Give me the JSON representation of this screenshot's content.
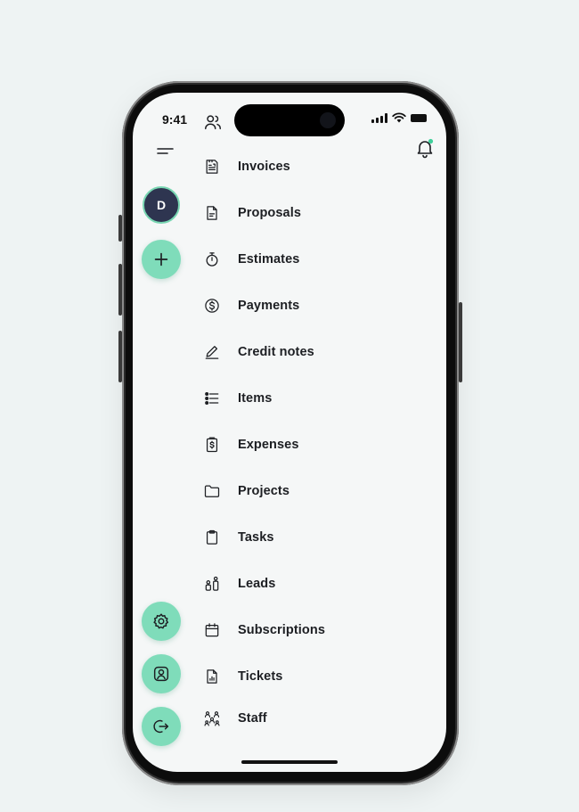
{
  "status_bar": {
    "time": "9:41"
  },
  "user": {
    "initial": "D"
  },
  "menu": {
    "items": [
      {
        "label": "Invoices",
        "icon": "invoice-icon"
      },
      {
        "label": "Proposals",
        "icon": "document-icon"
      },
      {
        "label": "Estimates",
        "icon": "stopwatch-icon"
      },
      {
        "label": "Payments",
        "icon": "dollar-circle-icon"
      },
      {
        "label": "Credit notes",
        "icon": "pencil-icon"
      },
      {
        "label": "Items",
        "icon": "list-icon"
      },
      {
        "label": "Expenses",
        "icon": "receipt-dollar-icon"
      },
      {
        "label": "Projects",
        "icon": "folder-icon"
      },
      {
        "label": "Tasks",
        "icon": "clipboard-icon"
      },
      {
        "label": "Leads",
        "icon": "people-icon"
      },
      {
        "label": "Subscriptions",
        "icon": "calendar-icon"
      },
      {
        "label": "Tickets",
        "icon": "report-icon"
      },
      {
        "label": "Staff",
        "icon": "team-icon"
      }
    ]
  },
  "colors": {
    "accent": "#7fdcba",
    "avatar_bg": "#2e3550",
    "screen_bg": "#f5f7f7",
    "notification_dot": "#3fcf9a"
  }
}
